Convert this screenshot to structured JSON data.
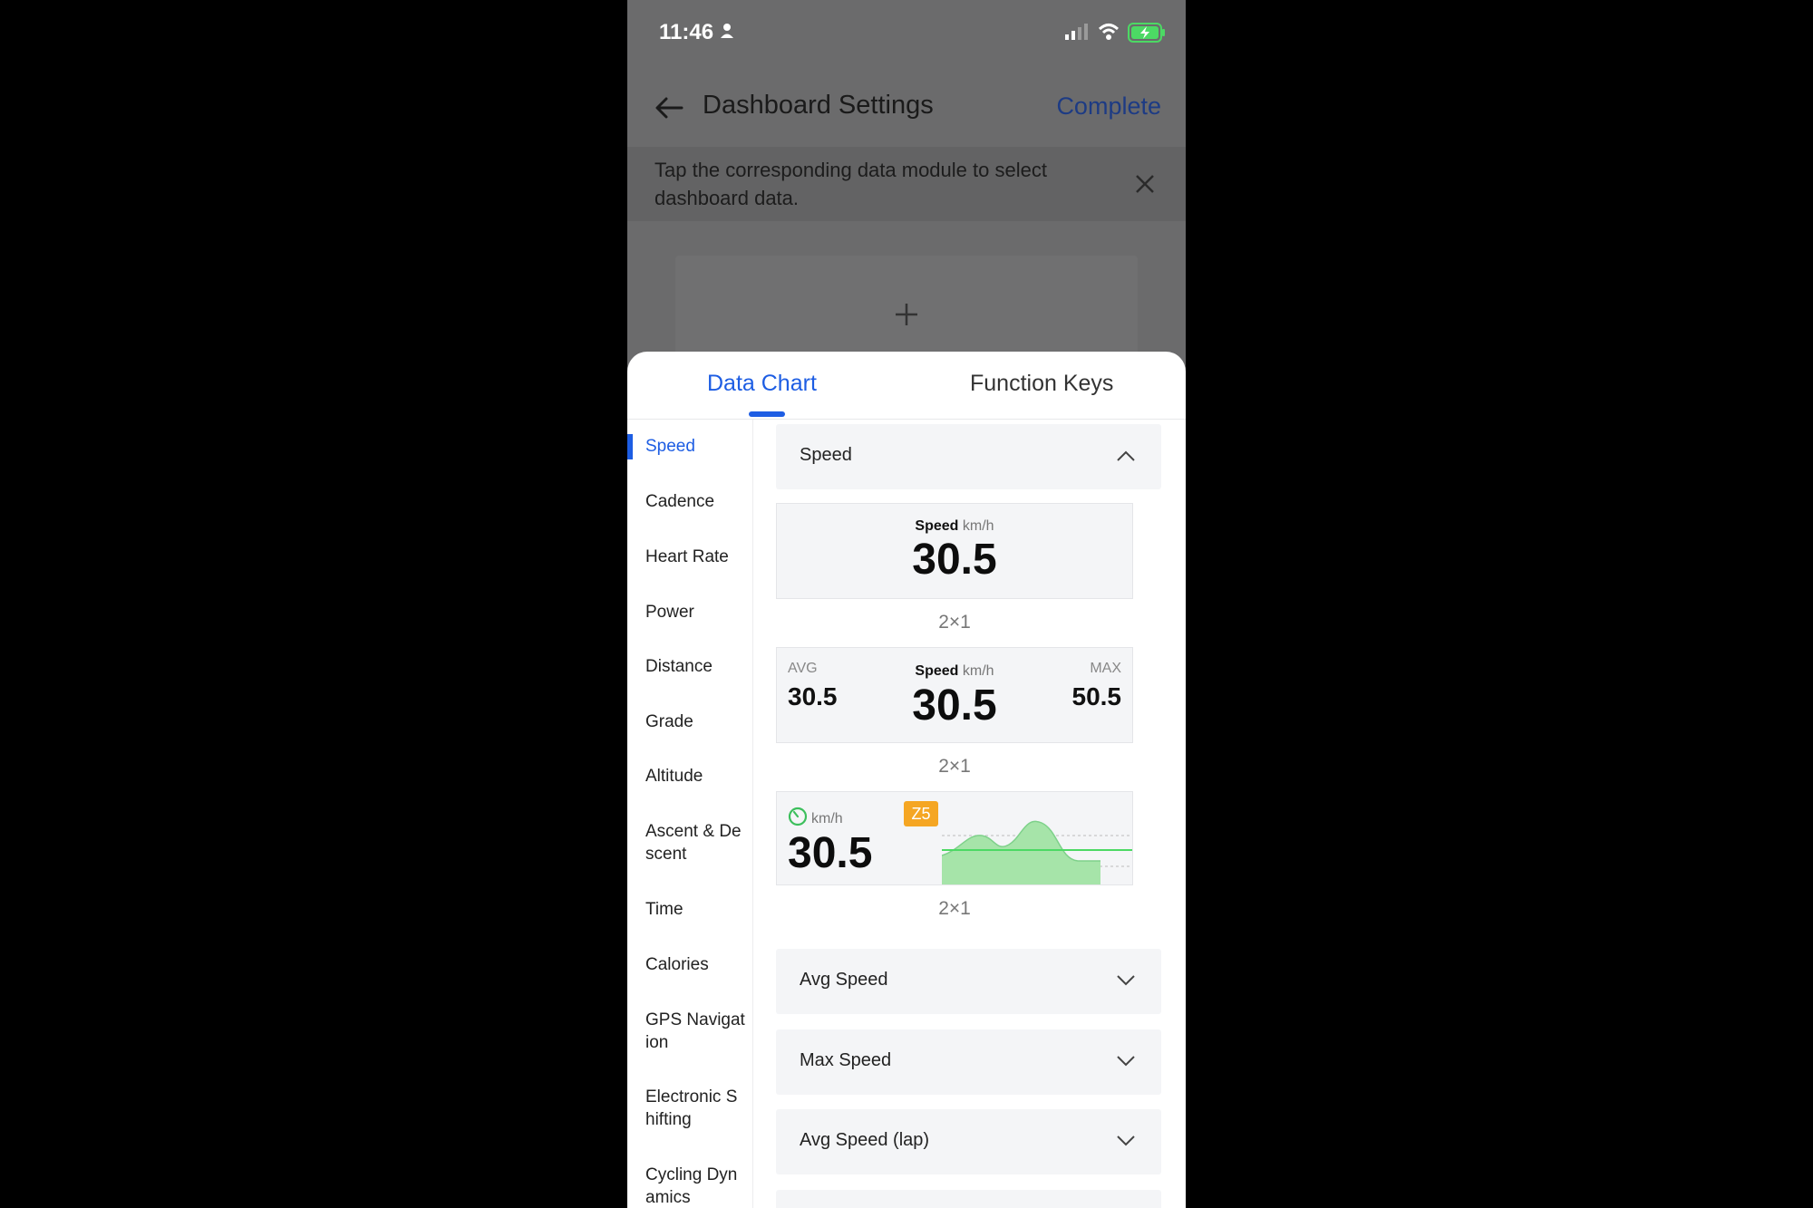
{
  "status_bar": {
    "time": "11:46"
  },
  "header": {
    "title": "Dashboard Settings",
    "complete_label": "Complete"
  },
  "tip": {
    "text": "Tap the corresponding data module to select dashboard data."
  },
  "tabs": [
    {
      "label": "Data Chart",
      "active": true
    },
    {
      "label": "Function Keys",
      "active": false
    }
  ],
  "sidebar": {
    "items": [
      {
        "label": "Speed"
      },
      {
        "label": "Cadence"
      },
      {
        "label": "Heart Rate"
      },
      {
        "label": "Power"
      },
      {
        "label": "Distance"
      },
      {
        "label": "Grade"
      },
      {
        "label": "Altitude"
      },
      {
        "label": "Ascent & De scent"
      },
      {
        "label": "Time"
      },
      {
        "label": "Calories"
      },
      {
        "label": "GPS Navigat ion"
      },
      {
        "label": "Electronic S hifting"
      },
      {
        "label": "Cycling Dyn amics"
      }
    ]
  },
  "content": {
    "sections": [
      {
        "label": "Speed",
        "expanded": true
      },
      {
        "label": "Avg Speed",
        "expanded": false
      },
      {
        "label": "Max Speed",
        "expanded": false
      },
      {
        "label": "Avg Speed (lap)",
        "expanded": false
      }
    ],
    "card1": {
      "name": "Speed",
      "unit": "km/h",
      "value": "30.5",
      "size": "2×1"
    },
    "card2": {
      "avg_label": "AVG",
      "avg_value": "30.5",
      "name": "Speed",
      "unit": "km/h",
      "value": "30.5",
      "max_label": "MAX",
      "max_value": "50.5",
      "size": "2×1"
    },
    "card3": {
      "unit": "km/h",
      "value": "30.5",
      "zone": "Z5",
      "size": "2×1"
    }
  },
  "colors": {
    "accent": "#1d5de3",
    "zone_badge": "#f5a623",
    "chart_green": "#4cd964",
    "chart_fill": "#a6e4a9"
  },
  "icons": [
    "back-arrow-icon",
    "close-icon",
    "plus-icon",
    "chevron-up-icon",
    "chevron-down-icon",
    "speedometer-icon",
    "person-icon",
    "signal-icon",
    "wifi-icon",
    "battery-charging-icon"
  ]
}
